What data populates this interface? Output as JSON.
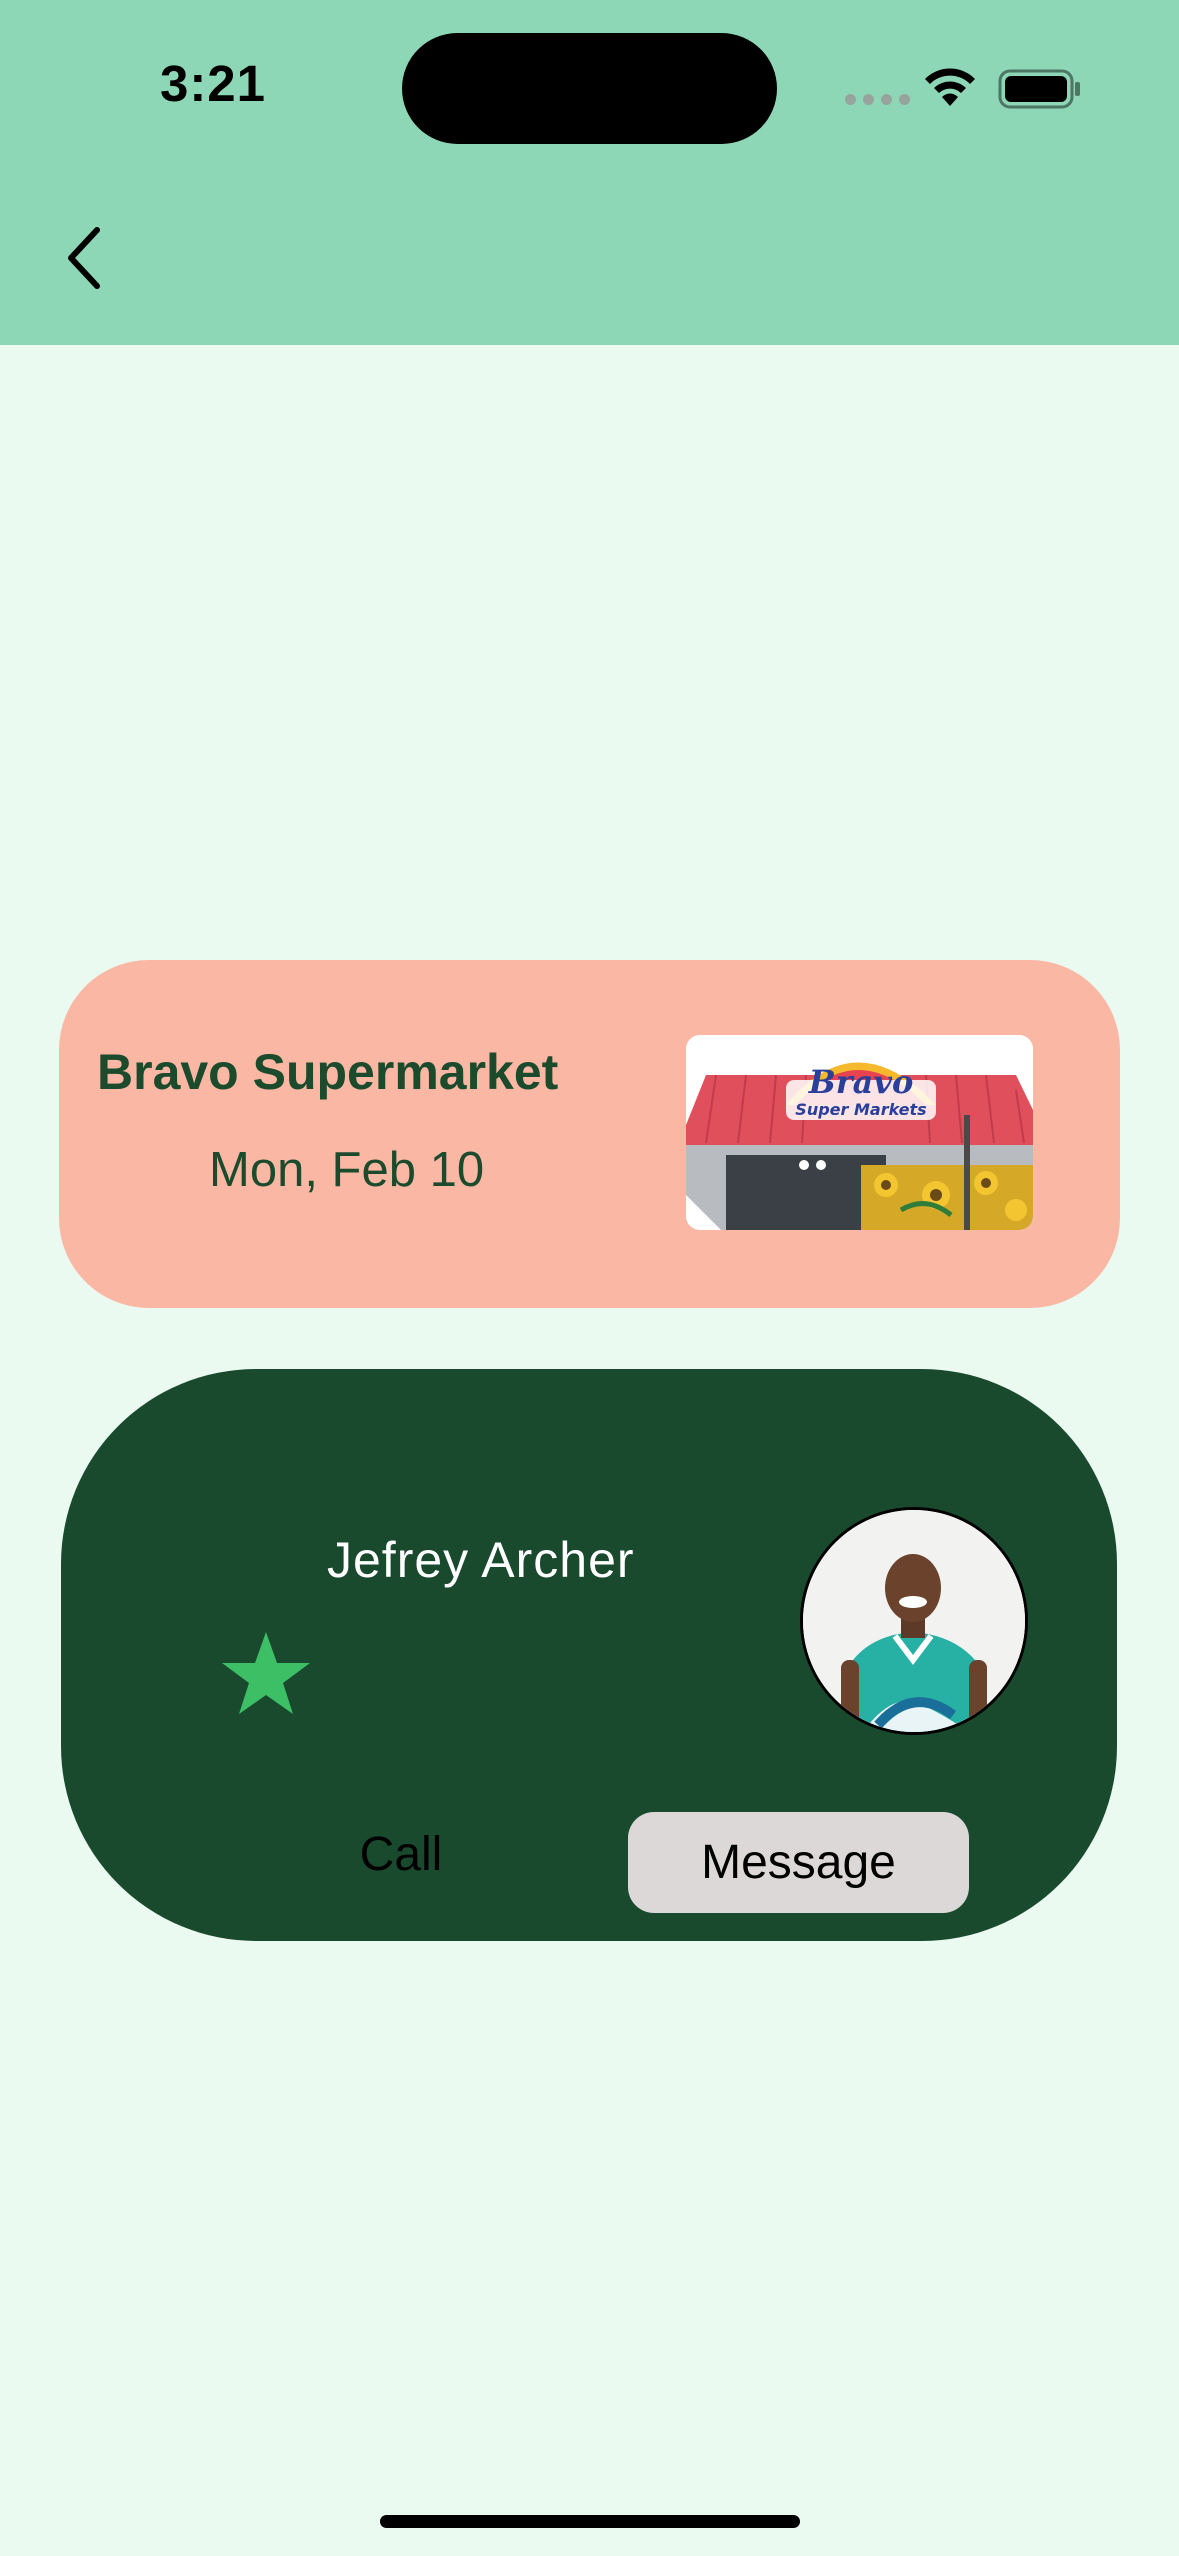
{
  "status_bar": {
    "time": "3:21",
    "wifi_icon": "wifi-icon",
    "battery_icon": "battery-icon"
  },
  "header": {
    "back_icon": "chevron-left-icon",
    "background_color": "#8dd7b7"
  },
  "store": {
    "name": "Bravo Supermarket",
    "date": "Mon, Feb 10",
    "image_icon": "store-photo",
    "card_color": "#fab7a3"
  },
  "contact": {
    "name": "Jefrey Archer",
    "star_icon": "star-icon",
    "avatar_icon": "avatar",
    "call_label": "Call",
    "message_label": "Message",
    "card_color": "#1a4a2e",
    "star_color": "#3dbf66"
  },
  "theme": {
    "page_background": "#eafaf1",
    "text_dark_green": "#1b4a2c"
  }
}
